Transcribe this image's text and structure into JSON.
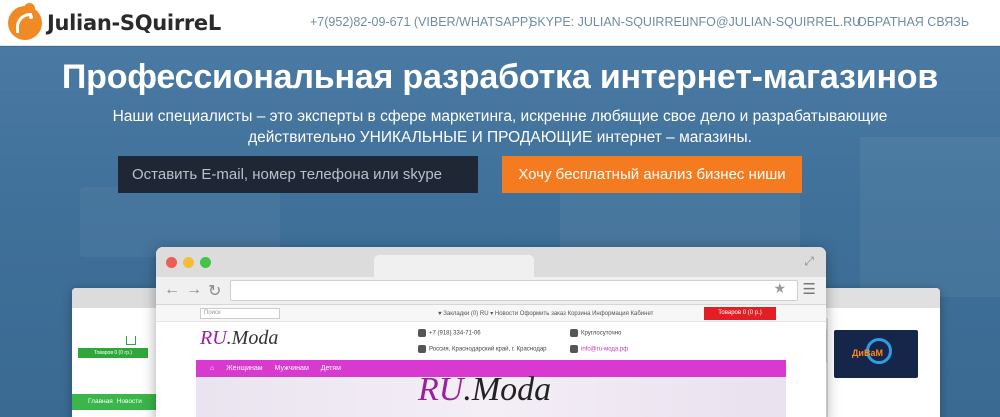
{
  "header": {
    "logo_text": "Julian-SQuirreL",
    "nav": [
      {
        "label": "+7(952)82-09-671 (VIBER/WHATSAPP)"
      },
      {
        "label": "SKYPE: JULIAN-SQUIRREL"
      },
      {
        "label": "INFO@JULIAN-SQUIRREL.RU"
      },
      {
        "label": "ОБРАТНАЯ СВЯЗЬ"
      }
    ]
  },
  "hero": {
    "title": "Профессиональная разработка интернет-магазинов",
    "subtitle_line1": "Наши специалисты – это эксперты в сфере маркетинга, искренне любящие свое дело и разрабатывающие",
    "subtitle_line2": "действительно УНИКАЛЬНЫЕ И ПРОДАЮЩИЕ интернет – магазины.",
    "input_placeholder": "Оставить E-mail, номер телефона или skype",
    "cta_label": "Хочу бесплатный анализ бизнес ниши"
  },
  "browser_mock": {
    "search_placeholder": "Поиск",
    "top_links": "♥  Закладки (0)   RU ▾   Новости   Оформить заказ   Корзина   Информация   Кабинет",
    "cart_label": "Товаров 0 (0 р.)",
    "logo_ru": "RU",
    "logo_rest": ".Moda",
    "phone": "+7 (918) 334-71-06",
    "address": "Россия, Краснодарский край, г. Краснодар",
    "hours": "Круглосуточно",
    "email": "info@ru-мода.рф",
    "menu": [
      "⌂",
      "Женщинам",
      "Мужчинам",
      "Детям"
    ],
    "banner_ru": "RU",
    "banner_rest": ".Moda"
  },
  "side_left": {
    "cart_label": "Товаров 0 (0 гр.)",
    "nav_main": "Главная",
    "nav_news": "Новости"
  },
  "side_right": {
    "logo_word": "ДиВаМ"
  },
  "colors": {
    "accent": "#f47b20",
    "hero_bg": "#3f7099",
    "input_bg": "#1e2733",
    "site_menu": "#d83ad0",
    "cart_red": "#e31e24",
    "green": "#3bb64a"
  }
}
